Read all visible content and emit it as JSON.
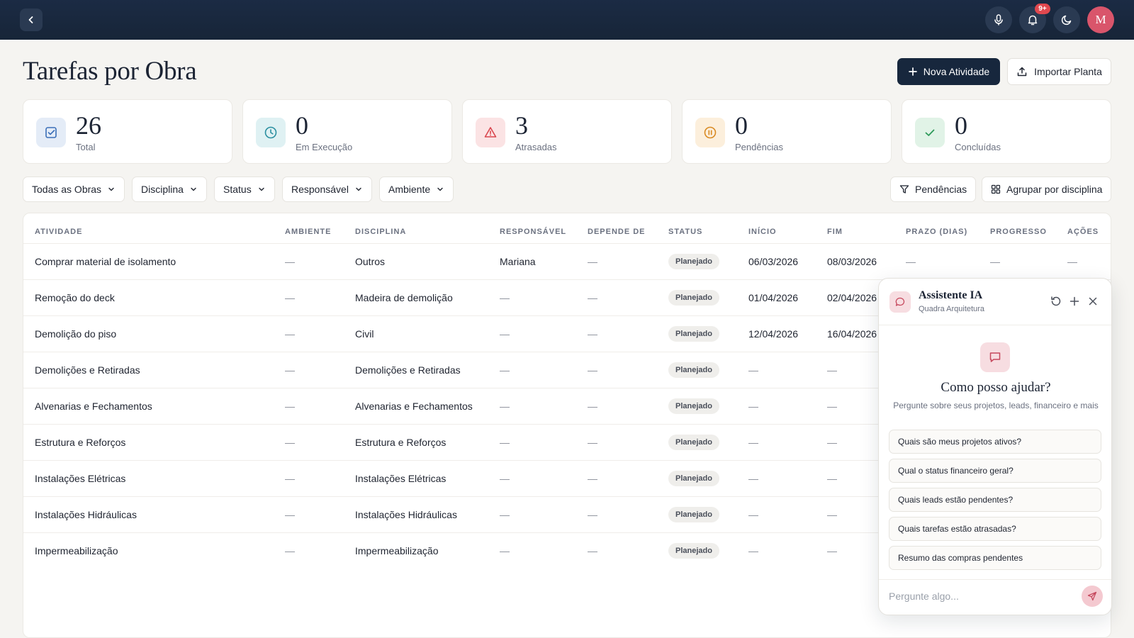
{
  "topbar": {
    "notifications_badge": "9+",
    "avatar_initial": "M"
  },
  "page": {
    "title": "Tarefas por Obra"
  },
  "actions": {
    "new_activity": "Nova Atividade",
    "import_plan": "Importar Planta"
  },
  "stats": [
    {
      "value": "26",
      "label": "Total",
      "icon": "checkbox-icon",
      "color": "#3b6fb8"
    },
    {
      "value": "0",
      "label": "Em Execução",
      "icon": "clock-icon",
      "color": "#2a8fa0"
    },
    {
      "value": "3",
      "label": "Atrasadas",
      "icon": "warning-icon",
      "color": "#d9464e"
    },
    {
      "value": "0",
      "label": "Pendências",
      "icon": "pause-icon",
      "color": "#d98a22"
    },
    {
      "value": "0",
      "label": "Concluídas",
      "icon": "check-icon",
      "color": "#2e9a5a"
    }
  ],
  "filters": {
    "obras": "Todas as Obras",
    "disciplina": "Disciplina",
    "status": "Status",
    "responsavel": "Responsável",
    "ambiente": "Ambiente",
    "pendencias": "Pendências",
    "agrupar": "Agrupar por disciplina"
  },
  "table": {
    "headers": {
      "atividade": "ATIVIDADE",
      "ambiente": "AMBIENTE",
      "disciplina": "DISCIPLINA",
      "responsavel": "RESPONSÁVEL",
      "depende": "DEPENDE DE",
      "status": "STATUS",
      "inicio": "INÍCIO",
      "fim": "FIM",
      "prazo": "PRAZO (DIAS)",
      "progresso": "PROGRESSO",
      "acoes": "AÇÕES"
    },
    "rows": [
      {
        "atividade": "Comprar material de isolamento",
        "ambiente": "—",
        "disciplina": "Outros",
        "responsavel": "Mariana",
        "depende": "—",
        "status": "Planejado",
        "inicio": "06/03/2026",
        "fim": "08/03/2026",
        "prazo": "—",
        "progresso": "—",
        "acoes": "—"
      },
      {
        "atividade": "Remoção do deck",
        "ambiente": "—",
        "disciplina": "Madeira de demolição",
        "responsavel": "—",
        "depende": "—",
        "status": "Planejado",
        "inicio": "01/04/2026",
        "fim": "02/04/2026"
      },
      {
        "atividade": "Demolição do piso",
        "ambiente": "—",
        "disciplina": "Civil",
        "responsavel": "—",
        "depende": "—",
        "status": "Planejado",
        "inicio": "12/04/2026",
        "fim": "16/04/2026"
      },
      {
        "atividade": "Demolições e Retiradas",
        "ambiente": "—",
        "disciplina": "Demolições e Retiradas",
        "responsavel": "—",
        "depende": "—",
        "status": "Planejado",
        "inicio": "—",
        "fim": "—"
      },
      {
        "atividade": "Alvenarias e Fechamentos",
        "ambiente": "—",
        "disciplina": "Alvenarias e Fechamentos",
        "responsavel": "—",
        "depende": "—",
        "status": "Planejado",
        "inicio": "—",
        "fim": "—"
      },
      {
        "atividade": "Estrutura e Reforços",
        "ambiente": "—",
        "disciplina": "Estrutura e Reforços",
        "responsavel": "—",
        "depende": "—",
        "status": "Planejado",
        "inicio": "—",
        "fim": "—"
      },
      {
        "atividade": "Instalações Elétricas",
        "ambiente": "—",
        "disciplina": "Instalações Elétricas",
        "responsavel": "—",
        "depende": "—",
        "status": "Planejado",
        "inicio": "—",
        "fim": "—"
      },
      {
        "atividade": "Instalações Hidráulicas",
        "ambiente": "—",
        "disciplina": "Instalações Hidráulicas",
        "responsavel": "—",
        "depende": "—",
        "status": "Planejado",
        "inicio": "—",
        "fim": "—"
      },
      {
        "atividade": "Impermeabilização",
        "ambiente": "—",
        "disciplina": "Impermeabilização",
        "responsavel": "—",
        "depende": "—",
        "status": "Planejado",
        "inicio": "—",
        "fim": "—"
      }
    ]
  },
  "assistant": {
    "title": "Assistente IA",
    "subtitle": "Quadra Arquitetura",
    "question": "Como posso ajudar?",
    "hint": "Pergunte sobre seus projetos, leads, financeiro e mais",
    "suggestions": [
      "Quais são meus projetos ativos?",
      "Qual o status financeiro geral?",
      "Quais leads estão pendentes?",
      "Quais tarefas estão atrasadas?",
      "Resumo das compras pendentes"
    ],
    "input_placeholder": "Pergunte algo..."
  }
}
